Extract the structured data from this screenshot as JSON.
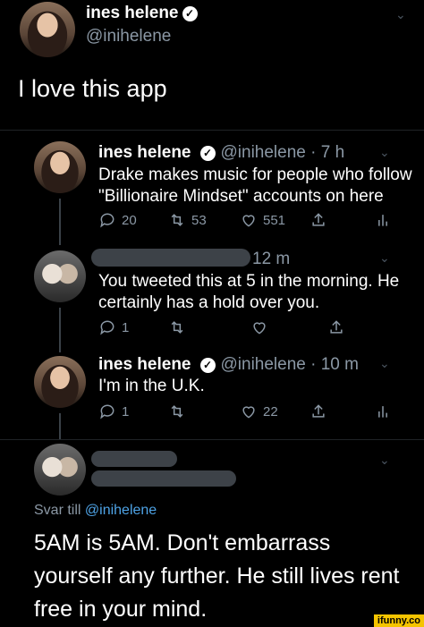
{
  "header": {
    "name": "ines helene",
    "handle": "@inihelene"
  },
  "main_tweet": {
    "text": "I love this app"
  },
  "thread": [
    {
      "name": "ines helene",
      "handle_time": "@inihelene · 7 h",
      "text_line1": "Drake makes music for people who follow",
      "text_line2": "\"Billionaire Mindset\" accounts on here",
      "replies": "20",
      "retweets": "53",
      "likes": "551"
    },
    {
      "time": "12 m",
      "text_line1": "You tweeted this at 5 in the morning. He",
      "text_line2": "certainly has a hold over you.",
      "replies": "1"
    },
    {
      "name": "ines helene",
      "handle_time": "@inihelene · 10 m",
      "text_line1": "I'm in the U.K.",
      "replies": "1",
      "likes": "22"
    }
  ],
  "reply": {
    "reply_to_prefix": "Svar till",
    "reply_to_handle": "@inihelene",
    "text_line1": "5AM is 5AM. Don't embarrass",
    "text_line2": "yourself any further. He still lives rent",
    "text_line3": "free in your mind."
  },
  "watermark": "ifunny.co",
  "colors": {
    "background": "#000000",
    "muted": "#8b98a5",
    "link": "#4ea3e6"
  }
}
